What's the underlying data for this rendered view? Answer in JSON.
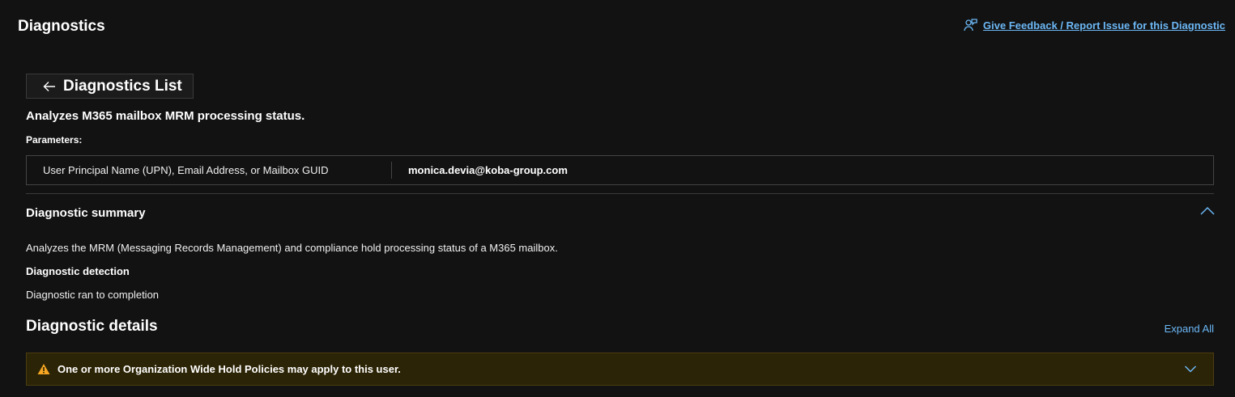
{
  "header": {
    "title": "Diagnostics",
    "feedback_link": "Give Feedback / Report Issue for this Diagnostic",
    "feedback_icon": "person-feedback-icon"
  },
  "back_button": {
    "label": "Diagnostics List",
    "icon": "arrow-left-icon"
  },
  "description": "Analyzes M365 mailbox MRM processing status.",
  "parameters": {
    "label": "Parameters:",
    "rows": [
      {
        "name": "User Principal Name (UPN), Email Address, or Mailbox GUID",
        "value": "monica.devia@koba-group.com"
      }
    ]
  },
  "summary": {
    "header": "Diagnostic summary",
    "text": "Analyzes the MRM (Messaging Records Management) and compliance hold processing status of a M365 mailbox.",
    "detection_label": "Diagnostic detection",
    "detection_text": "Diagnostic ran to completion",
    "toggle_icon": "chevron-up-icon"
  },
  "details": {
    "header": "Diagnostic details",
    "expand_all": "Expand All",
    "warning": {
      "text": "One or more Organization Wide Hold Policies may apply to this user.",
      "icon": "warning-triangle-icon",
      "toggle_icon": "chevron-down-icon"
    }
  },
  "colors": {
    "background": "#121212",
    "link": "#6cb8f6",
    "warning_bg": "#2c2406",
    "warning_icon": "#f5a623"
  }
}
